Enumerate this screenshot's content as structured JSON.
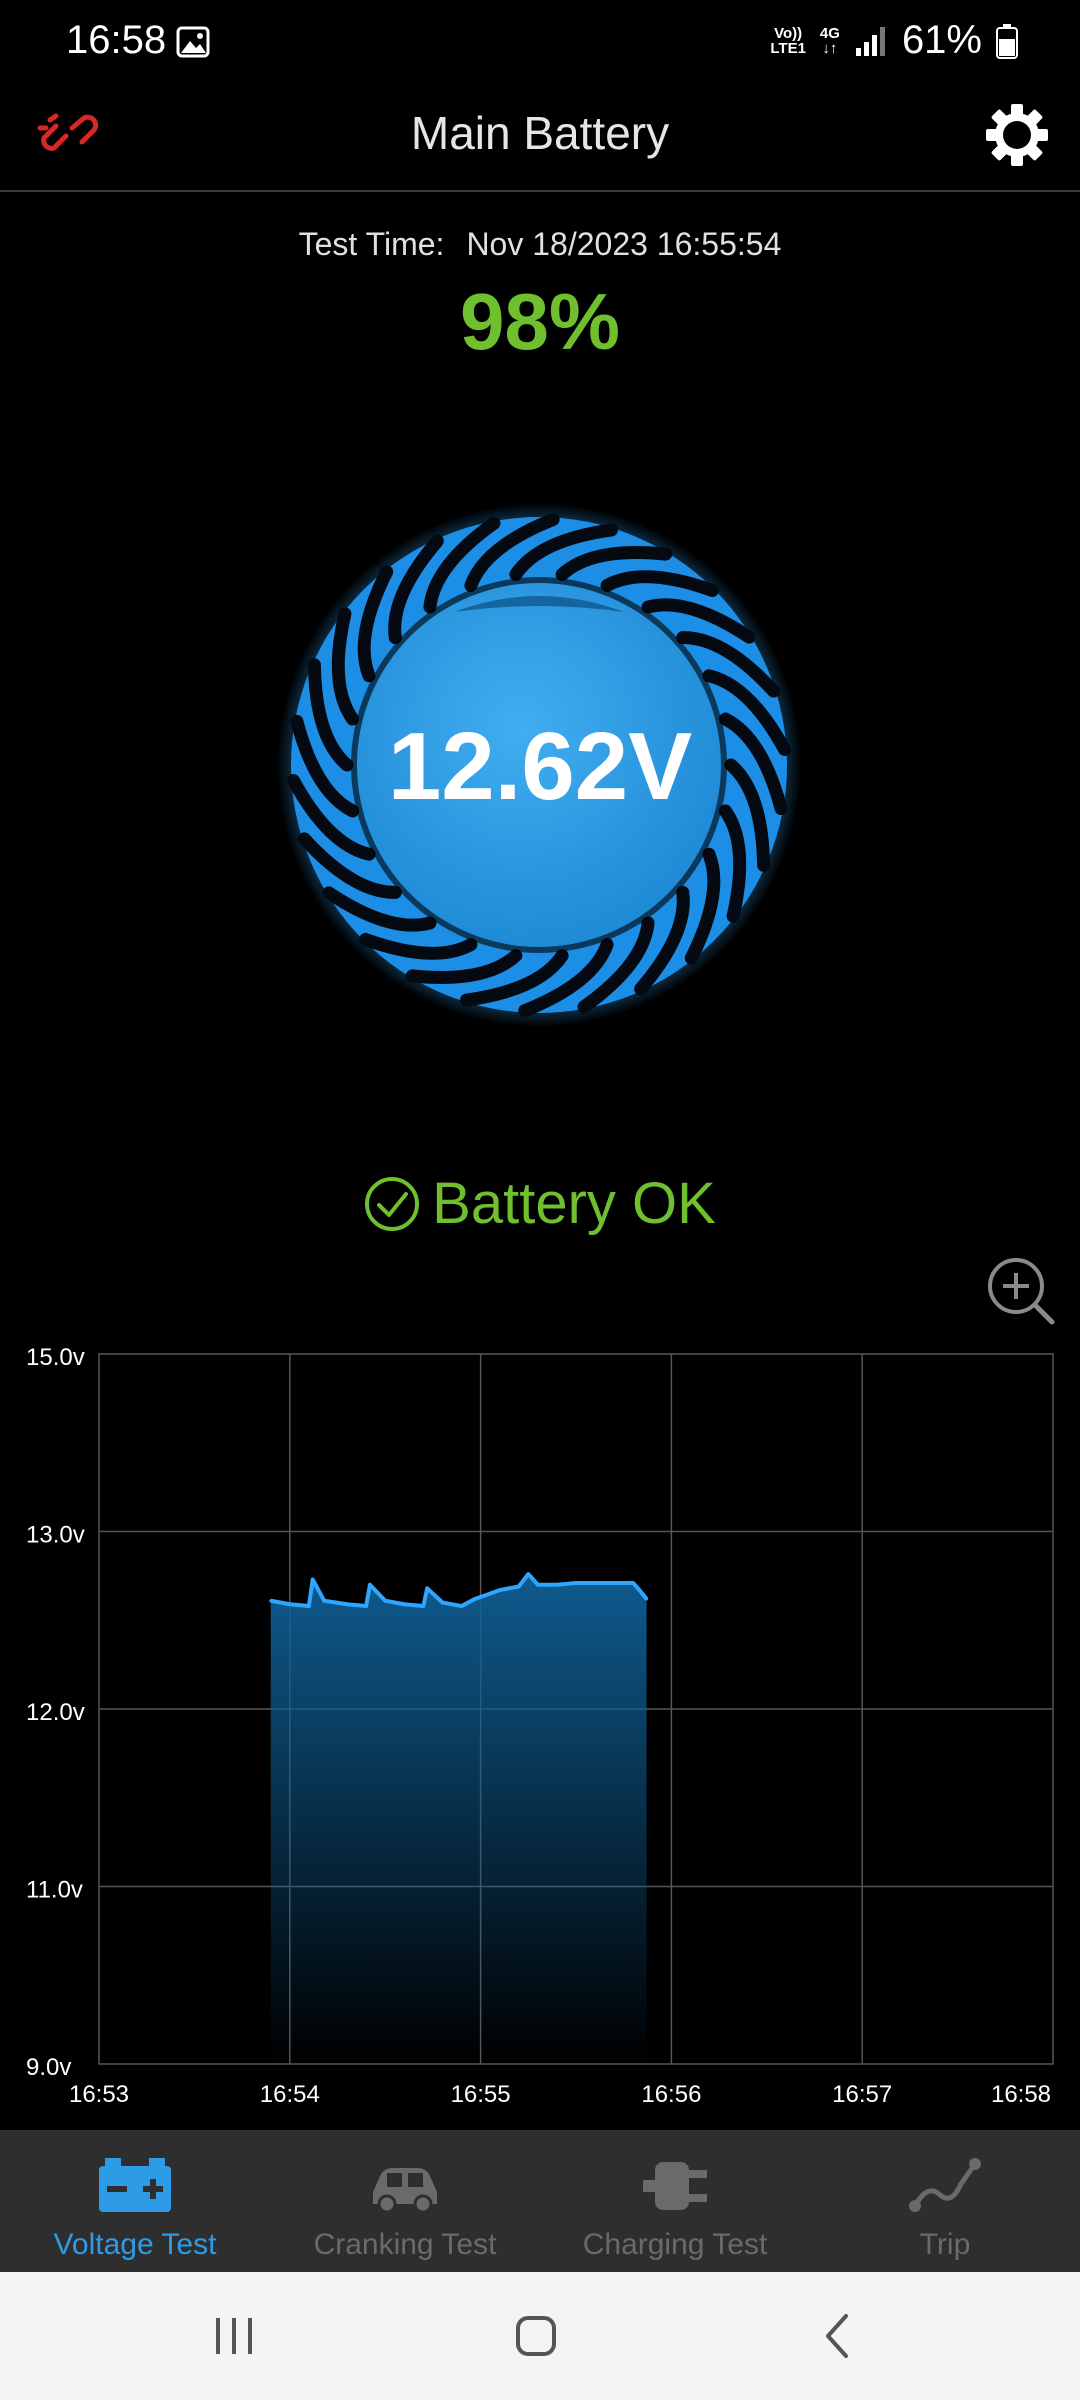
{
  "status_bar": {
    "time": "16:58",
    "network_top": "Vo))",
    "network_bottom": "LTE1",
    "net_type": "4G",
    "battery_percent": "61%"
  },
  "header": {
    "title": "Main Battery",
    "left_icon": "link-icon",
    "right_icon": "gear-icon"
  },
  "test": {
    "time_label": "Test Time:",
    "time_value": "Nov 18/2023 16:55:54",
    "charge_percent": "98%",
    "voltage": "12.62V",
    "status": "Battery OK"
  },
  "colors": {
    "accent": "#2e9be6",
    "ok_green": "#6fbf2f",
    "nav_inactive": "#6a6a6a"
  },
  "chart_data": {
    "type": "area",
    "y_tick_labels": [
      "15.0v",
      "13.0v",
      "12.0v",
      "11.0v",
      "9.0v"
    ],
    "x_tick_labels": [
      "16:53",
      "16:54",
      "16:55",
      "16:56",
      "16:57",
      "16:58"
    ],
    "y_levels": [
      15.0,
      13.0,
      12.0,
      11.0,
      9.0
    ],
    "xlim_minutes": [
      0,
      5
    ],
    "grid": true,
    "series": [
      {
        "x": [
          0.9,
          1.0,
          1.1,
          1.12,
          1.18,
          1.3,
          1.4,
          1.42,
          1.5,
          1.6,
          1.7,
          1.72,
          1.8,
          1.9,
          1.97,
          2.1,
          2.2,
          2.25,
          2.3,
          2.4,
          2.5,
          2.6,
          2.7,
          2.8,
          2.84,
          2.87
        ],
        "y": [
          12.61,
          12.59,
          12.58,
          12.73,
          12.61,
          12.59,
          12.58,
          12.7,
          12.61,
          12.59,
          12.58,
          12.68,
          12.6,
          12.58,
          12.62,
          12.67,
          12.69,
          12.76,
          12.7,
          12.7,
          12.71,
          12.71,
          12.71,
          12.71,
          12.66,
          12.62
        ]
      }
    ]
  },
  "nav": {
    "items": [
      {
        "label": "Voltage Test",
        "icon": "car-battery-icon"
      },
      {
        "label": "Cranking Test",
        "icon": "car-icon"
      },
      {
        "label": "Charging Test",
        "icon": "plug-icon"
      },
      {
        "label": "Trip",
        "icon": "route-icon"
      }
    ]
  },
  "system_nav": {
    "recents": "recents-icon",
    "home": "home-icon",
    "back": "back-icon"
  }
}
